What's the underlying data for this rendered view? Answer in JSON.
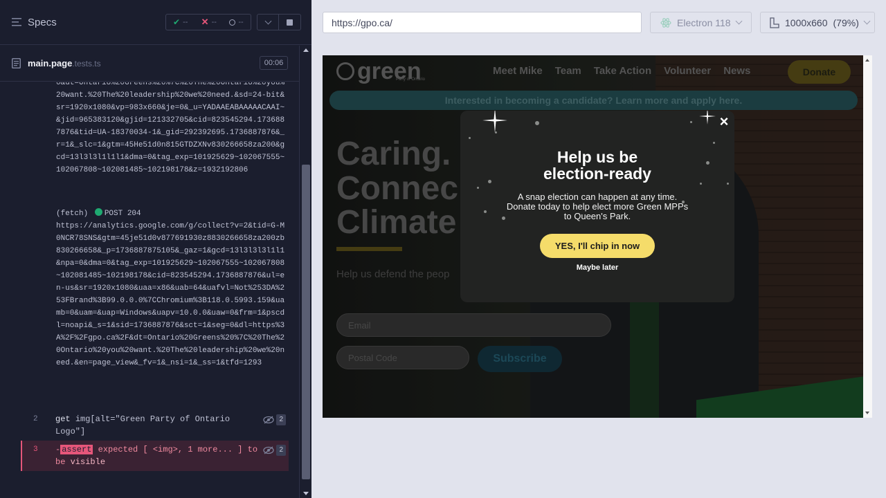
{
  "runner": {
    "specs_title": "Specs",
    "status": {
      "passed": "--",
      "failed": "--",
      "pending": "--"
    },
    "spec": {
      "name": "main.page",
      "ext": ".tests.ts",
      "duration": "00:06"
    },
    "log": {
      "block1": "0&dt=Ontario%20Greens%20%7C%20The%20Ontario%20you%20want.%20The%20leadership%20we%20need.&sd=24-bit&sr=1920x1080&vp=983x660&je=0&_u=YADAAEABAAAAACAAI~&jid=965383120&gjid=121332705&cid=823545294.1736887876&tid=UA-18370034-1&_gid=292392695.1736887876&_r=1&_slc=1&gtm=45He51d0n815GTDZXNv830266658za200&gcd=13l3l3l1l1l1&dma=0&tag_exp=101925629~102067555~102067808~102081485~102198178&z=1932192806",
      "fetch_label": "(fetch)",
      "fetch_method": "POST 204",
      "block2": "https://analytics.google.com/g/collect?v=2&tid=G-M0NCR78SNS&gtm=45je51d0v877691930z8830266658za200zb830266658&_p=1736887875105&_gaz=1&gcd=13l3l3l3l1l1&npa=0&dma=0&tag_exp=101925629~102067555~102067808~102081485~102198178&cid=823545294.1736887876&ul=en-us&sr=1920x1080&uaa=x86&uab=64&uafvl=Not%253DA%253FBrand%3B99.0.0.0%7CChromium%3B118.0.5993.159&uamb=0&uam=&uap=Windows&uapv=10.0.0&uaw=0&frm=1&pscdl=noapi&_s=1&sid=1736887876&sct=1&seg=0&dl=https%3A%2F%2Fgpo.ca%2F&dt=Ontario%20Greens%20%7C%20The%20Ontario%20you%20want.%20The%20leadership%20we%20need.&en=page_view&_fv=1&_nsi=1&_ss=1&tfd=1293"
    },
    "commands": [
      {
        "num": "2",
        "name": "get",
        "arg": "img[alt=\"Green Party of Ontario Logo\"]",
        "count": "2"
      },
      {
        "num": "3",
        "prefix": "-",
        "name": "assert",
        "message_a": "expected",
        "message_b": "[ <img>, 1 more... ]",
        "message_c": "to be",
        "message_d": "visible",
        "count": "2"
      }
    ]
  },
  "browser": {
    "url": "https://gpo.ca/",
    "browser_name": "Electron 118",
    "viewport": "1000x660",
    "zoom": "(79%)"
  },
  "site": {
    "logo_word": "green",
    "logo_sub": "Party of Ontario",
    "nav": [
      "Meet Mike",
      "Team",
      "Take Action",
      "Volunteer",
      "News"
    ],
    "donate": "Donate",
    "candidate_bar": "Interested in becoming a candidate? Learn more and apply here.",
    "hero": [
      "Caring.",
      "Connec",
      "Climate"
    ],
    "hero_sub": "Help us defend the peop",
    "email_placeholder": "Email",
    "postal_placeholder": "Postal Code",
    "subscribe": "Subscribe"
  },
  "modal": {
    "title_line1": "Help us be",
    "title_line2": "election-ready",
    "body_line1": "A snap election can happen at any time.",
    "body_line2": "Donate today to help elect more Green MPPs",
    "body_line3": "to Queen's Park.",
    "cta": "YES, I'll chip in now",
    "later": "Maybe later",
    "close": "×"
  },
  "colors": {
    "runner_bg": "#1b1e2e",
    "assert_fail": "#e6567a",
    "modal_cta": "#f5dc6a",
    "fetch_dot": "#1fa971"
  }
}
